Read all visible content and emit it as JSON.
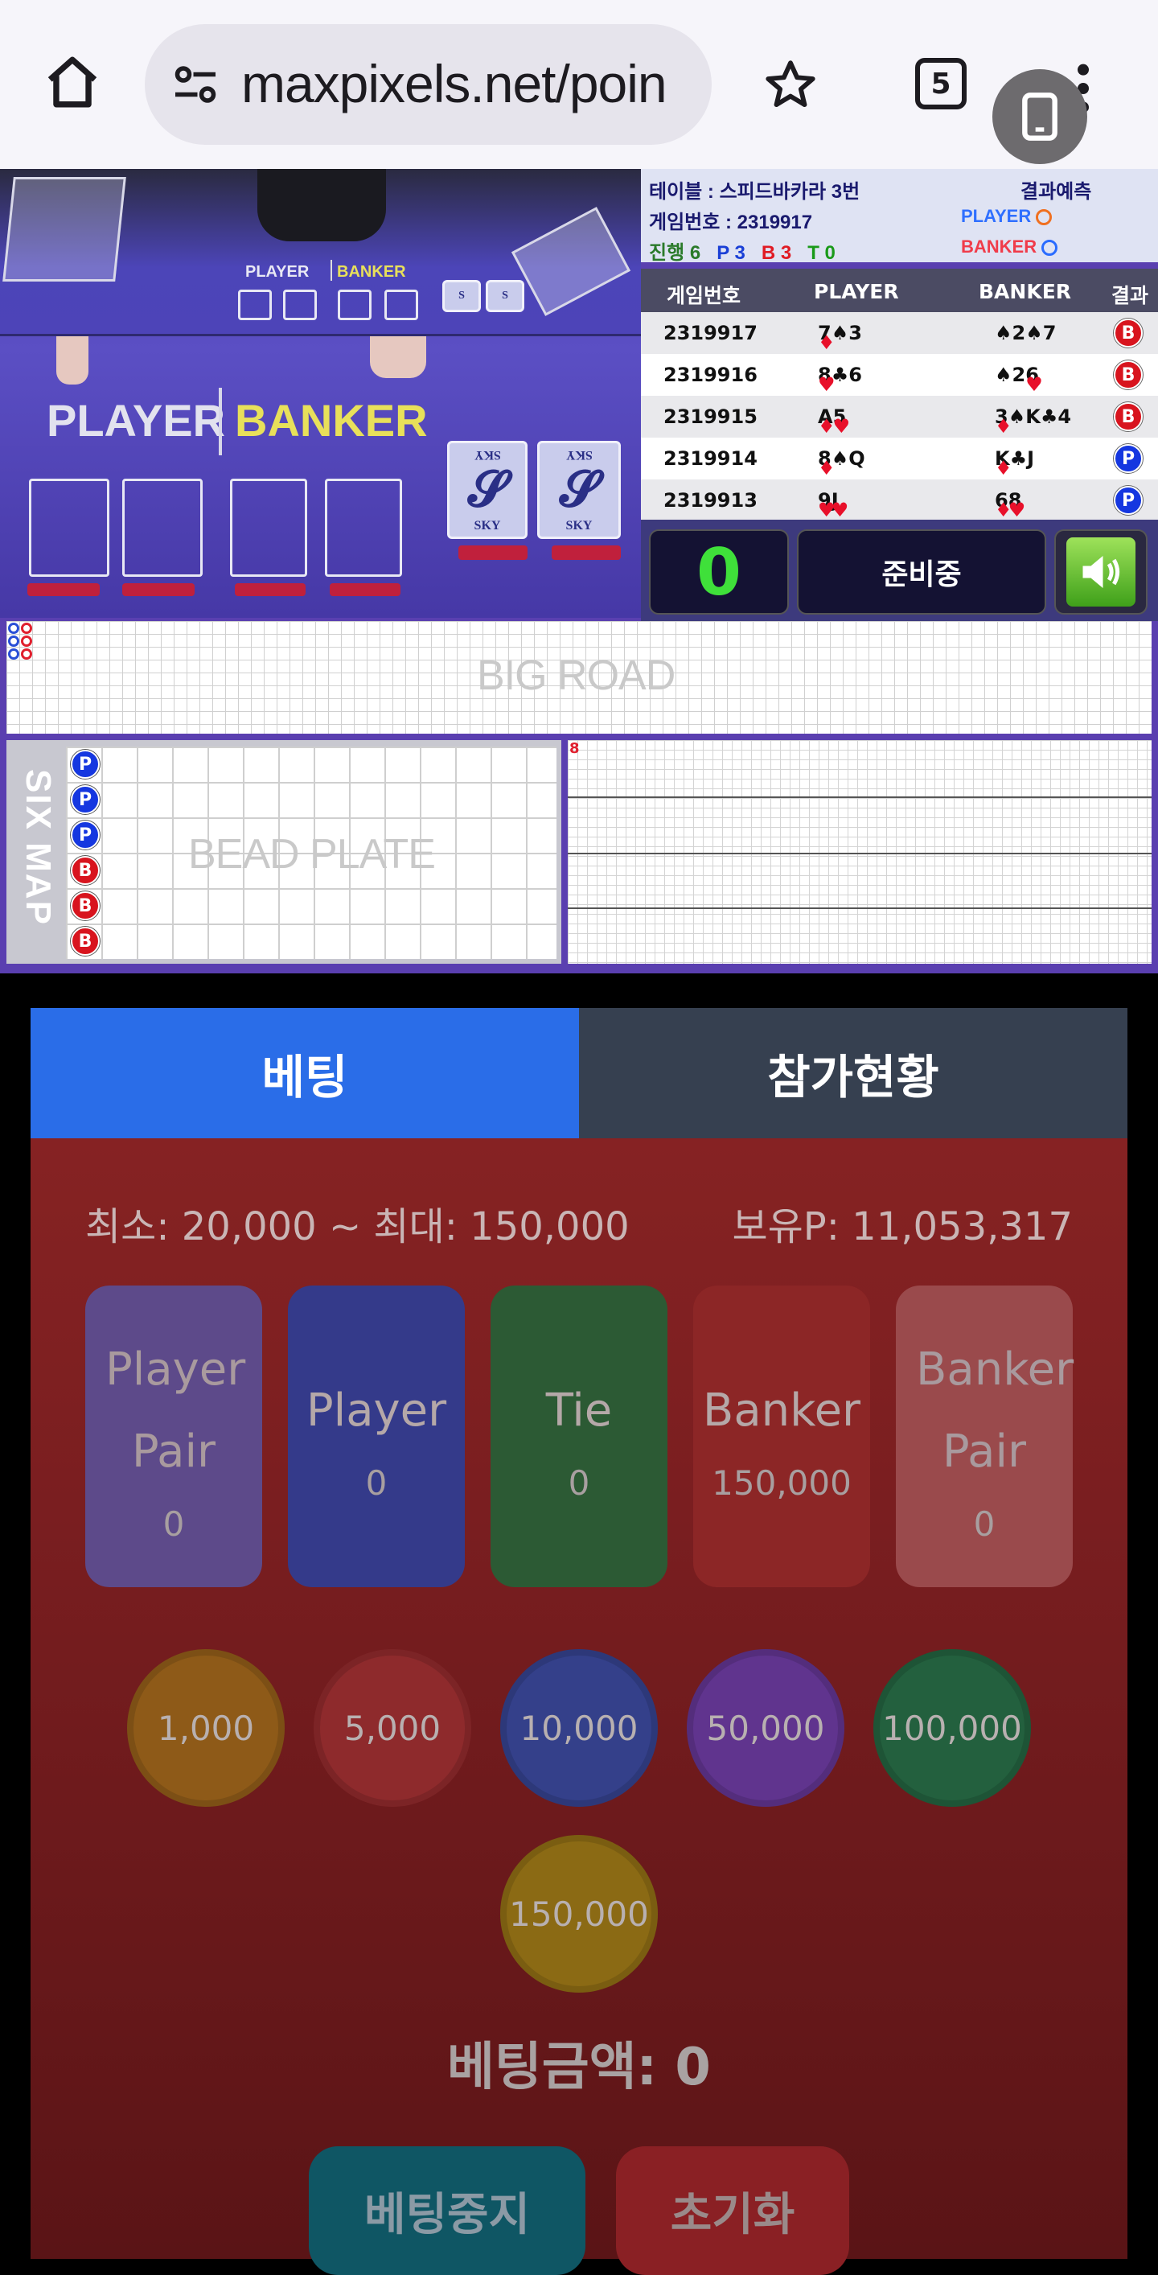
{
  "browser": {
    "url": "maxpixels.net/poin",
    "tab_count": "5"
  },
  "video": {
    "felt_player_small": "PLAYER",
    "felt_banker_small": "BANKER",
    "felt_player": "PLAYER",
    "felt_banker": "BANKER",
    "card_logo": "SKY"
  },
  "info": {
    "table_label": "테이블 : 스피드바카라 3번",
    "game_no_label": "게임번호 : 2319917",
    "progress_label": "진행",
    "progress_total": "6",
    "progress_p": "P 3",
    "progress_b": "B 3",
    "progress_t": "T 0",
    "predict_label": "결과예측",
    "predict_player": "PLAYER",
    "predict_banker": "BANKER"
  },
  "history": {
    "headers": [
      "게임번호",
      "PLAYER",
      "BANKER",
      "결과"
    ],
    "rows": [
      {
        "no": "2319917",
        "player": "♦7♠3",
        "banker": "♠2♠7",
        "result": "B"
      },
      {
        "no": "2319916",
        "player": "♥8♣6",
        "banker": "♠2♥6",
        "result": "B"
      },
      {
        "no": "2319915",
        "player": "♦A♥5",
        "banker": "♦3♠K♣4",
        "result": "B"
      },
      {
        "no": "2319914",
        "player": "♦8♠Q",
        "banker": "♦K♣J",
        "result": "P"
      },
      {
        "no": "2319913",
        "player": "♥9♥J",
        "banker": "♦6♥8",
        "result": "P"
      }
    ]
  },
  "control": {
    "timer": "0",
    "status": "준비중"
  },
  "roads": {
    "big_road_title": "BIG ROAD",
    "six_map": "SIX MAP",
    "bead_plate_title": "BEAD PLATE",
    "bead": [
      "P",
      "P",
      "P",
      "B",
      "B",
      "B"
    ],
    "small_road_mark": "8"
  },
  "betting": {
    "tab_bet": "베팅",
    "tab_status": "참가현황",
    "limit": "최소: 20,000 ~ 최대: 150,000",
    "points": "보유P: 11,053,317",
    "options": [
      {
        "name": "Player Pair",
        "amount": "0",
        "color": "#5d4a8a"
      },
      {
        "name": "Player",
        "amount": "0",
        "color": "#343a8a"
      },
      {
        "name": "Tie",
        "amount": "0",
        "color": "#2c5a34"
      },
      {
        "name": "Banker",
        "amount": "150,000",
        "color": "#8c2626"
      },
      {
        "name": "Banker Pair",
        "amount": "0",
        "color": "#9a4a4c"
      }
    ],
    "chips": [
      {
        "label": "1,000",
        "color": "#8e5a18"
      },
      {
        "label": "5,000",
        "color": "#8e2a2c"
      },
      {
        "label": "10,000",
        "color": "#34408a"
      },
      {
        "label": "50,000",
        "color": "#60348e"
      },
      {
        "label": "100,000",
        "color": "#23603e"
      },
      {
        "label": "150,000",
        "color": "#8b6a14"
      }
    ],
    "bet_amount": "베팅금액: 0",
    "stop_button": "베팅중지",
    "reset_button": "초기화"
  }
}
